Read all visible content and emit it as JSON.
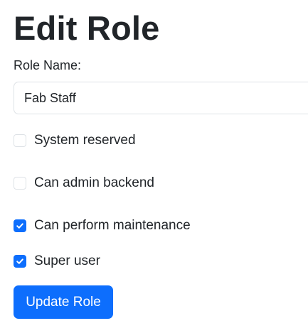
{
  "page": {
    "title": "Edit Role"
  },
  "form": {
    "role_name_label": "Role Name:",
    "role_name_value": "Fab Staff",
    "checkboxes": [
      {
        "label": "System reserved",
        "checked": false
      },
      {
        "label": "Can admin backend",
        "checked": false
      },
      {
        "label": "Can perform maintenance",
        "checked": true
      },
      {
        "label": "Super user",
        "checked": true
      }
    ],
    "submit_label": "Update Role"
  },
  "colors": {
    "accent": "#0d6efd",
    "border": "#dee2e6",
    "text": "#212529"
  }
}
